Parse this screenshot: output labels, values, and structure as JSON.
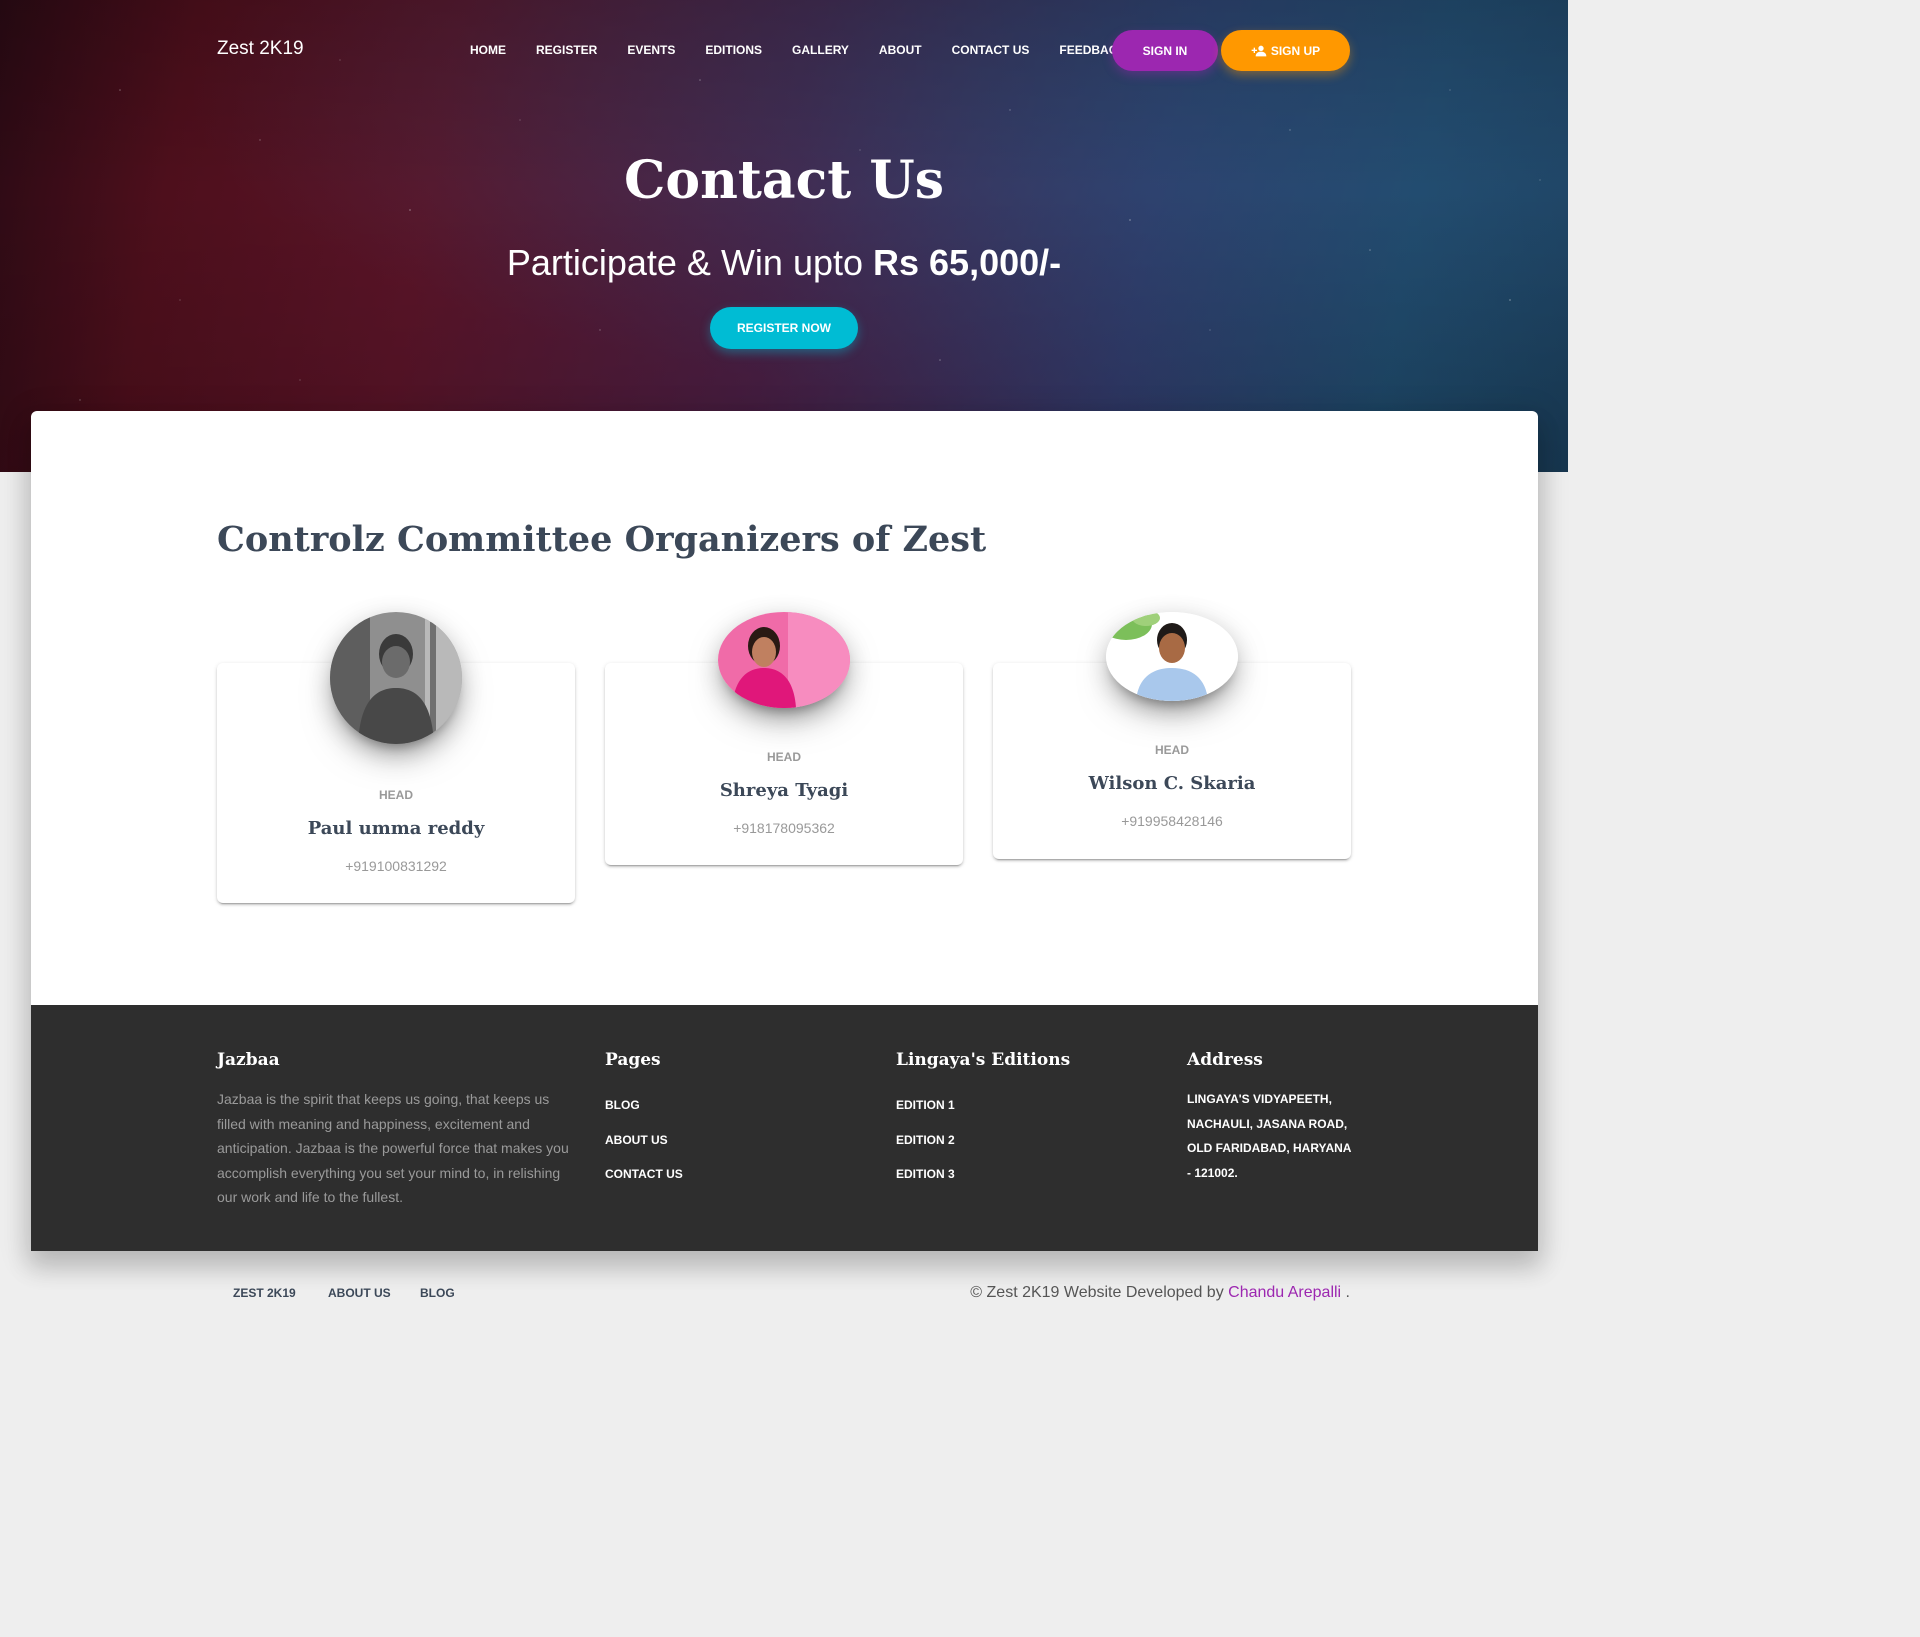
{
  "nav": {
    "brand": "Zest 2K19",
    "links": [
      "HOME",
      "REGISTER",
      "EVENTS",
      "EDITIONS",
      "GALLERY",
      "ABOUT",
      "CONTACT US",
      "FEEDBACK"
    ],
    "sign_in": "SIGN IN",
    "sign_up": "SIGN UP"
  },
  "hero": {
    "title": "Contact Us",
    "subtitle_prefix": "Participate & Win upto ",
    "subtitle_bold": "Rs 65,000/-",
    "cta": "REGISTER NOW"
  },
  "team": {
    "title": "Controlz Committee Organizers of Zest",
    "members": [
      {
        "role": "HEAD",
        "name": "Paul umma reddy",
        "phone": "+919100831292"
      },
      {
        "role": "HEAD",
        "name": "Shreya Tyagi",
        "phone": "+918178095362"
      },
      {
        "role": "HEAD",
        "name": "Wilson C. Skaria",
        "phone": "+919958428146"
      }
    ]
  },
  "footer": {
    "about_title": "Jazbaa",
    "about_text": "Jazbaa is the spirit that keeps us going, that keeps us filled with meaning and happiness, excitement and anticipation. Jazbaa is the powerful force that makes you accomplish everything you set your mind to, in relishing our work and life to the fullest.",
    "pages_title": "Pages",
    "pages": [
      "BLOG",
      "ABOUT US",
      "CONTACT US"
    ],
    "editions_title": "Lingaya's Editions",
    "editions": [
      "EDITION 1",
      "EDITION 2",
      "EDITION 3"
    ],
    "address_title": "Address",
    "address": "LINGAYA'S VIDYAPEETH, NACHAULI, JASANA ROAD, OLD FARIDABAD, HARYANA - 121002."
  },
  "bottom": {
    "links": [
      "ZEST 2K19",
      "ABOUT US",
      "BLOG"
    ],
    "copyright_prefix": "© Zest 2K19 Website Developed by ",
    "author": "Chandu Arepalli",
    "copyright_suffix": " ."
  },
  "colors": {
    "sign_in": "#9c27b0",
    "sign_up": "#ff9800",
    "register": "#00bcd4",
    "footer_bg": "#2e2e2e"
  }
}
